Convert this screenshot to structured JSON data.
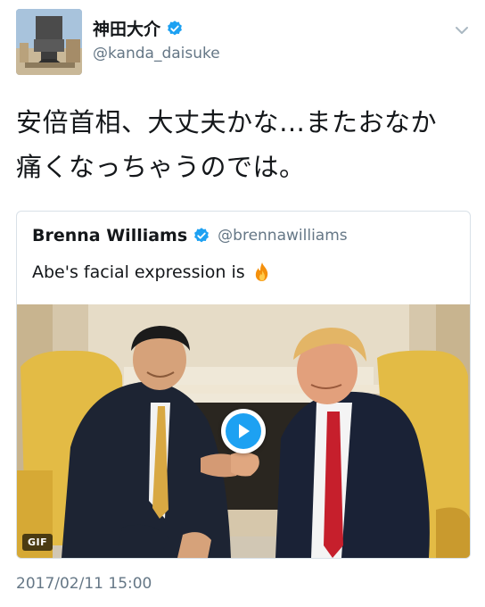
{
  "author": {
    "name": "神田大介",
    "handle": "@kanda_daisuke",
    "verified": true,
    "avatar_icon": "avatar-photo"
  },
  "tweet": {
    "lines": [
      "安倍首相、大丈夫かな…またおなか",
      "痛くなっちゃうのでは。"
    ],
    "timestamp": "2017/02/11 15:00"
  },
  "quoted_tweet": {
    "name": "Brenna Williams",
    "handle": "@brennawilliams",
    "verified": true,
    "text": "Abe's facial expression is",
    "emoji_icon": "fire-icon",
    "media": {
      "type_label": "GIF",
      "play_icon": "play-icon"
    }
  },
  "colors": {
    "verified_blue": "#1da1f2",
    "secondary_text": "#657786",
    "border": "#d9e1e8",
    "text": "#14171a"
  },
  "menu_icon": "chevron-down-icon"
}
